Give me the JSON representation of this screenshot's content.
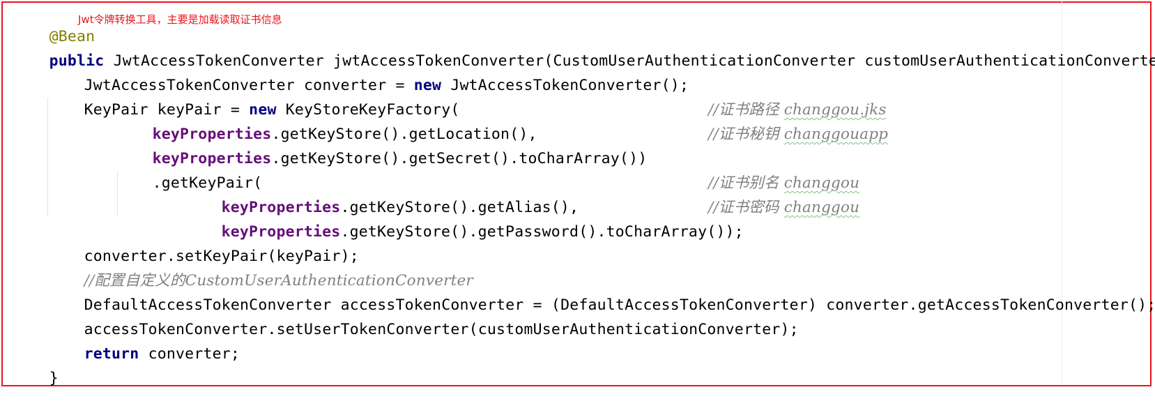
{
  "annotation_note": "Jwt令牌转换工具，主要是加载读取证书信息",
  "code": {
    "l1": {
      "annotation": "@Bean"
    },
    "l2": {
      "kw_public": "public",
      "rest": " JwtAccessTokenConverter jwtAccessTokenConverter(CustomUserAuthenticationConverter customUserAuthenticationConverter) {"
    },
    "l3": {
      "a": "JwtAccessTokenConverter converter = ",
      "kw_new": "new",
      "b": " JwtAccessTokenConverter();"
    },
    "l4": {
      "a": "KeyPair keyPair = ",
      "kw_new": "new",
      "b": " KeyStoreKeyFactory("
    },
    "l5": {
      "field": "keyProperties",
      "rest": ".getKeyStore().getLocation(),",
      "comment": "//证书路径 ",
      "comment_value": "changgou.jks"
    },
    "l6": {
      "field": "keyProperties",
      "rest": ".getKeyStore().getSecret().toCharArray())",
      "comment": "//证书秘钥 ",
      "comment_value": "changgouapp"
    },
    "l7": {
      "text": ".getKeyPair("
    },
    "l8": {
      "field": "keyProperties",
      "rest": ".getKeyStore().getAlias(),",
      "comment": "//证书别名 ",
      "comment_value": "changgou"
    },
    "l9": {
      "field": "keyProperties",
      "rest": ".getKeyStore().getPassword().toCharArray());",
      "comment": "//证书密码 ",
      "comment_value": "changgou"
    },
    "l10": {
      "text": "converter.setKeyPair(keyPair);"
    },
    "l11": {
      "comment": "//配置自定义的CustomUserAuthenticationConverter"
    },
    "l12": {
      "text": "DefaultAccessTokenConverter accessTokenConverter = (DefaultAccessTokenConverter) converter.getAccessTokenConverter();"
    },
    "l13": {
      "text": "accessTokenConverter.setUserTokenConverter(customUserAuthenticationConverter);"
    },
    "l14": {
      "kw_return": "return",
      "rest": " converter;"
    },
    "l15": {
      "text": "}"
    }
  },
  "colors": {
    "border": "#e8141c",
    "note": "#e8141c",
    "keyword": "#000080",
    "annotation": "#808000",
    "field": "#660e7a",
    "comment": "#808080"
  }
}
